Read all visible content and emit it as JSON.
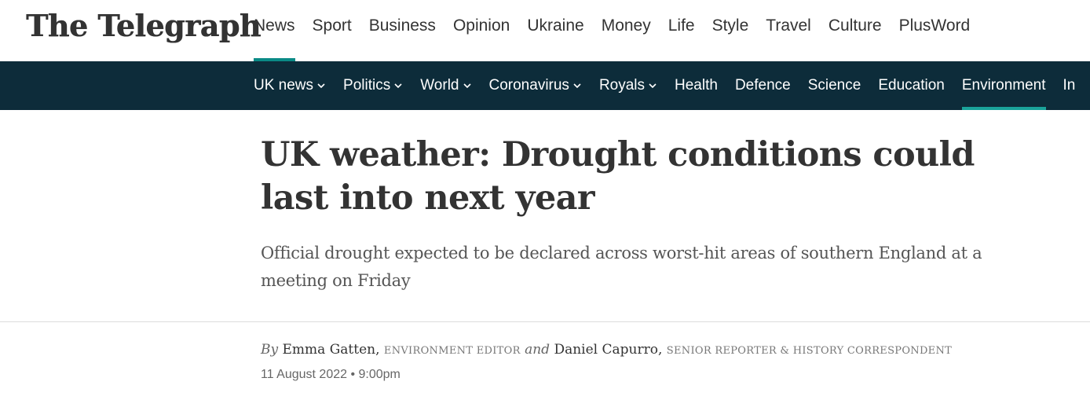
{
  "brand": {
    "logo_text": "The Telegraph"
  },
  "primary_nav": [
    {
      "label": "News",
      "active": true
    },
    {
      "label": "Sport"
    },
    {
      "label": "Business"
    },
    {
      "label": "Opinion"
    },
    {
      "label": "Ukraine"
    },
    {
      "label": "Money"
    },
    {
      "label": "Life"
    },
    {
      "label": "Style"
    },
    {
      "label": "Travel"
    },
    {
      "label": "Culture"
    },
    {
      "label": "PlusWord"
    }
  ],
  "sub_nav": [
    {
      "label": "UK news",
      "dropdown": true
    },
    {
      "label": "Politics",
      "dropdown": true
    },
    {
      "label": "World",
      "dropdown": true
    },
    {
      "label": "Coronavirus",
      "dropdown": true
    },
    {
      "label": "Royals",
      "dropdown": true
    },
    {
      "label": "Health"
    },
    {
      "label": "Defence"
    },
    {
      "label": "Science"
    },
    {
      "label": "Education"
    },
    {
      "label": "Environment",
      "active": true
    },
    {
      "label": "In"
    }
  ],
  "article": {
    "headline": "UK weather: Drought conditions could last into next year",
    "standfirst": "Official drought expected to be declared across worst-hit areas of southern England at a meeting on Friday",
    "byline": {
      "by": "By",
      "author1": "Emma Gatten,",
      "role1": "ENVIRONMENT EDITOR",
      "and": "and",
      "author2": "Daniel Capurro,",
      "role2": "SENIOR REPORTER & HISTORY CORRESPONDENT"
    },
    "date": "11 August 2022 • 9:00pm"
  },
  "colors": {
    "subnav_bg": "#0d2c3a",
    "accent": "#0a8a86"
  }
}
